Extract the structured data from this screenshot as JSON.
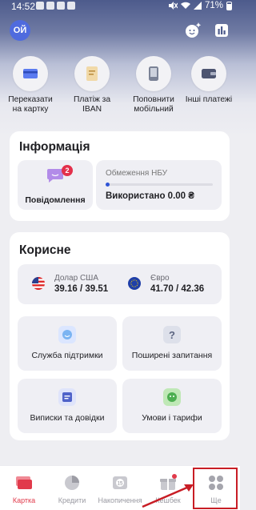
{
  "status": {
    "time": "14:52",
    "battery": "71%"
  },
  "header": {
    "avatar_initials": "ОЙ"
  },
  "quick_actions": [
    {
      "label": "Переказати на картку",
      "icon": "card-icon"
    },
    {
      "label": "Платіж за IBAN",
      "icon": "document-icon"
    },
    {
      "label": "Поповнити мобільний",
      "icon": "phone-icon"
    },
    {
      "label": "Інші платежі",
      "icon": "wallet-icon"
    }
  ],
  "info": {
    "title": "Інформація",
    "notifications": {
      "label": "Повідомлення",
      "badge": "2"
    },
    "limit": {
      "title": "Обмеження НБУ",
      "used": "Використано 0.00 ₴",
      "progress": 0
    }
  },
  "useful": {
    "title": "Корисне",
    "fx": [
      {
        "name": "Долар США",
        "rate": "39.16 / 39.51"
      },
      {
        "name": "Євро",
        "rate": "41.70 / 42.36"
      }
    ],
    "tiles": [
      {
        "label": "Служба підтримки",
        "icon": "support-icon"
      },
      {
        "label": "Поширені запитання",
        "icon": "question-icon"
      },
      {
        "label": "Виписки та довідки",
        "icon": "statements-icon"
      },
      {
        "label": "Умови і тарифи",
        "icon": "terms-icon"
      }
    ]
  },
  "nav": [
    {
      "label": "Картка",
      "icon": "cards-icon",
      "active": true
    },
    {
      "label": "Кредити",
      "icon": "pie-chart-icon",
      "active": false
    },
    {
      "label": "Накопичення",
      "icon": "savings-icon",
      "active": false
    },
    {
      "label": "Кешбек",
      "icon": "gift-icon",
      "active": false
    },
    {
      "label": "Ще",
      "icon": "more-icon",
      "active": false
    }
  ],
  "colors": {
    "accent": "#e13a4b",
    "primary": "#2f54d6",
    "highlight": "#c81d25"
  }
}
